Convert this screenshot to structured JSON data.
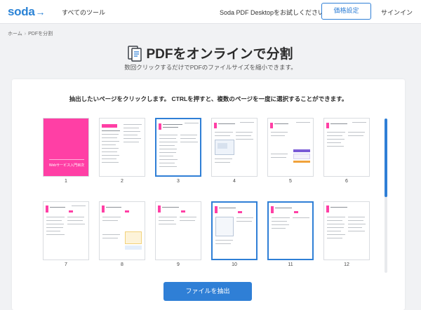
{
  "header": {
    "logo": "soda",
    "logo_arrow": "→",
    "nav_tools": "すべてのツール",
    "nav_trial": "Soda PDF Desktopをお試しください",
    "pricing_button": "価格設定",
    "signin": "サインイン"
  },
  "breadcrumb": {
    "home": "ホーム",
    "separator": "›",
    "current": "PDFを分割"
  },
  "page": {
    "title": "PDFをオンラインで分割",
    "subtitle": "数回クリックするだけでPDFのファイルサイズを縮小できます。"
  },
  "panel": {
    "instruction": "抽出したいページをクリックします。 CTRLを押すと、複数のページを一度に選択することができます。",
    "extract_button": "ファイルを抽出"
  },
  "pages": [
    {
      "number": "1",
      "selected": false,
      "cover_text": "Webサービス入門目次"
    },
    {
      "number": "2",
      "selected": false
    },
    {
      "number": "3",
      "selected": true
    },
    {
      "number": "4",
      "selected": false
    },
    {
      "number": "5",
      "selected": false
    },
    {
      "number": "6",
      "selected": false
    },
    {
      "number": "7",
      "selected": false
    },
    {
      "number": "8",
      "selected": false
    },
    {
      "number": "9",
      "selected": false
    },
    {
      "number": "10",
      "selected": true
    },
    {
      "number": "11",
      "selected": true
    },
    {
      "number": "12",
      "selected": false
    }
  ],
  "colors": {
    "accent": "#2f7fd6",
    "cover_pink": "#ff3fa5"
  }
}
